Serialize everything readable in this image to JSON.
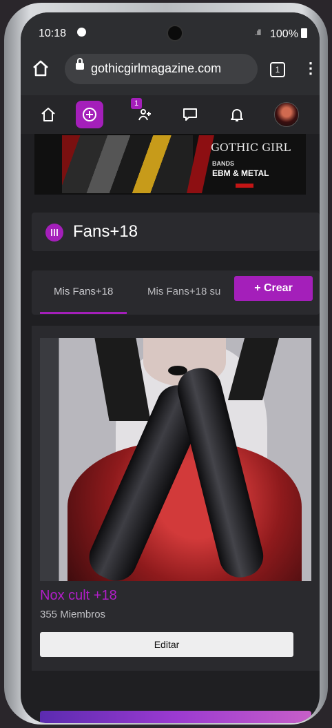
{
  "status_bar": {
    "time": "10:18",
    "signal": ".ıll",
    "battery": "100%"
  },
  "browser": {
    "url": "gothicgirlmagazine.com",
    "tab_count": "1",
    "more": "⋮"
  },
  "site_nav": {
    "friend_requests_badge": "1"
  },
  "banner": {
    "logo": "GOTHIC GIRL",
    "subtitle": "BANDS",
    "title": "EBM & METAL"
  },
  "section": {
    "title": "Fans+18"
  },
  "tabs": {
    "items": [
      "Mis Fans+18",
      "Mis Fans+18 su"
    ],
    "create_label": "+ Crear"
  },
  "group": {
    "name": "Nox cult +18",
    "members": "355 Miembros",
    "edit_label": "Editar"
  },
  "colors": {
    "accent": "#a41fba",
    "background": "#1f1f22",
    "card": "#2a2a2e"
  }
}
